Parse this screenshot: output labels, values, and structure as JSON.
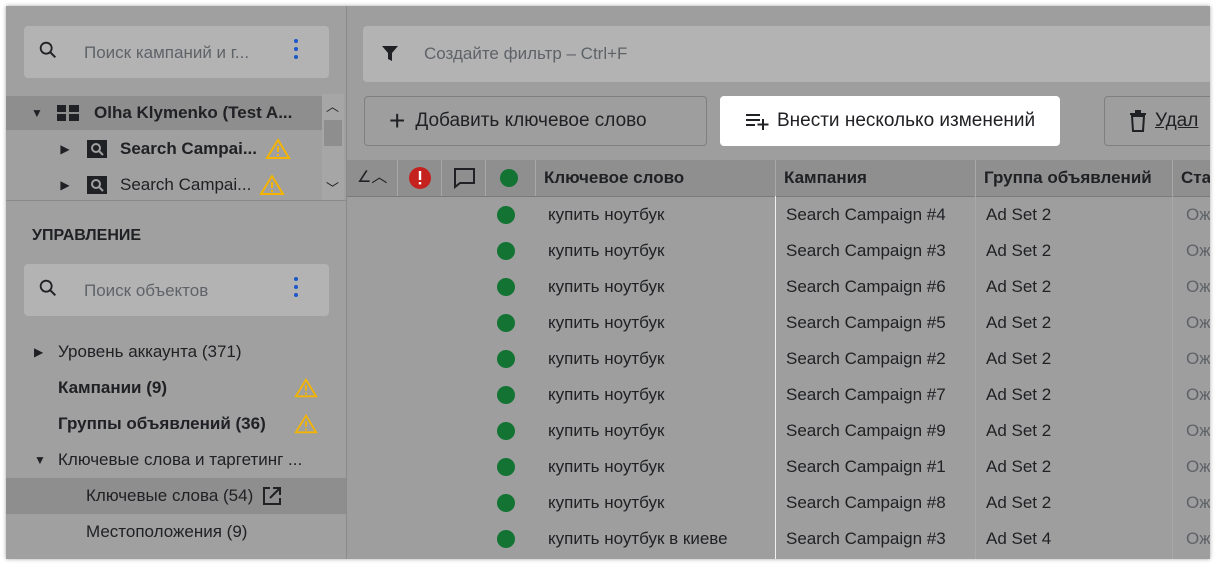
{
  "sidebar": {
    "campaign_search": {
      "placeholder": "Поиск кампаний и г..."
    },
    "account": {
      "name": "Olha Klymenko (Test A..."
    },
    "campaigns": [
      {
        "name": "Search Campai...",
        "bold": true
      },
      {
        "name": "Search Campai...",
        "bold": false
      }
    ],
    "section_title": "УПРАВЛЕНИЕ",
    "object_search": {
      "placeholder": "Поиск объектов"
    },
    "nav": [
      {
        "label": "Уровень аккаунта (371)"
      },
      {
        "label": "Кампании (9)"
      },
      {
        "label": "Группы объявлений (36)"
      },
      {
        "label": "Ключевые слова и таргетинг ..."
      },
      {
        "label": "Ключевые слова (54)"
      },
      {
        "label": "Местоположения (9)"
      }
    ]
  },
  "main": {
    "filter": {
      "placeholder": "Создайте фильтр – Ctrl+F"
    },
    "toolbar": {
      "add_keyword": "Добавить ключевое слово",
      "bulk_edit": "Внести несколько изменений",
      "delete": "Удал"
    },
    "table": {
      "columns": [
        "Ключевое слово",
        "Кампания",
        "Группа объявлений",
        "Стат"
      ],
      "rows": [
        {
          "keyword": "купить ноутбук",
          "campaign": "Search Campaign #4",
          "adgroup": "Ad Set 2",
          "status": "Ожи"
        },
        {
          "keyword": "купить ноутбук",
          "campaign": "Search Campaign #3",
          "adgroup": "Ad Set 2",
          "status": "Ожи"
        },
        {
          "keyword": "купить ноутбук",
          "campaign": "Search Campaign #6",
          "adgroup": "Ad Set 2",
          "status": "Ожи"
        },
        {
          "keyword": "купить ноутбук",
          "campaign": "Search Campaign #5",
          "adgroup": "Ad Set 2",
          "status": "Ожи"
        },
        {
          "keyword": "купить ноутбук",
          "campaign": "Search Campaign #2",
          "adgroup": "Ad Set 2",
          "status": "Ожи"
        },
        {
          "keyword": "купить ноутбук",
          "campaign": "Search Campaign #7",
          "adgroup": "Ad Set 2",
          "status": "Ожи"
        },
        {
          "keyword": "купить ноутбук",
          "campaign": "Search Campaign #9",
          "adgroup": "Ad Set 2",
          "status": "Ожи"
        },
        {
          "keyword": "купить ноутбук",
          "campaign": "Search Campaign #1",
          "adgroup": "Ad Set 2",
          "status": "Ожи"
        },
        {
          "keyword": "купить ноутбук",
          "campaign": "Search Campaign #8",
          "adgroup": "Ad Set 2",
          "status": "Ожи"
        },
        {
          "keyword": "купить ноутбук в киеве",
          "campaign": "Search Campaign #3",
          "adgroup": "Ad Set 4",
          "status": "Ожи"
        }
      ]
    }
  },
  "colors": {
    "status_enabled": "#137333",
    "error": "#c5221f",
    "warning": "#f4b400",
    "accent": "#1a57c8"
  }
}
